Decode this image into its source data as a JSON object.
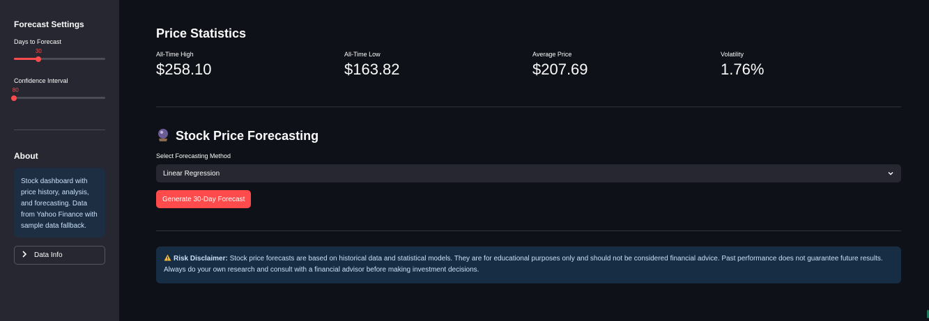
{
  "sidebar": {
    "settings_title": "Forecast Settings",
    "days_slider": {
      "label": "Days to Forecast",
      "value": "30",
      "fraction": 0.27
    },
    "confidence_slider": {
      "label": "Confidence Interval",
      "value": "80",
      "fraction": 0.0
    },
    "about_title": "About",
    "about_text": "Stock dashboard with price history, analysis, and forecasting. Data from Yahoo Finance with sample data fallback.",
    "data_info_label": "Data Info"
  },
  "stats": {
    "title": "Price Statistics",
    "metrics": [
      {
        "label": "All-Time High",
        "value": "$258.10"
      },
      {
        "label": "All-Time Low",
        "value": "$163.82"
      },
      {
        "label": "Average Price",
        "value": "$207.69"
      },
      {
        "label": "Volatility",
        "value": "1.76%"
      }
    ]
  },
  "forecast": {
    "title": "Stock Price Forecasting",
    "select_label": "Select Forecasting Method",
    "selected_method": "Linear Regression",
    "generate_label": "Generate 30-Day Forecast"
  },
  "disclaimer": {
    "bold": "Risk Disclaimer:",
    "text": " Stock price forecasts are based on historical data and statistical models. They are for educational purposes only and should not be considered financial advice. Past performance does not guarantee future results. Always do your own research and consult with a financial advisor before making investment decisions."
  },
  "colors": {
    "accent": "#ff4b4b",
    "background": "#0e1117",
    "sidebar": "#262730",
    "info_bg": "#172d43",
    "info_text": "#c7e0f7"
  },
  "icons": {
    "forecast": "crystal-ball-icon",
    "warning": "warning-icon",
    "expander": "chevron-right-icon",
    "select": "chevron-down-icon"
  }
}
